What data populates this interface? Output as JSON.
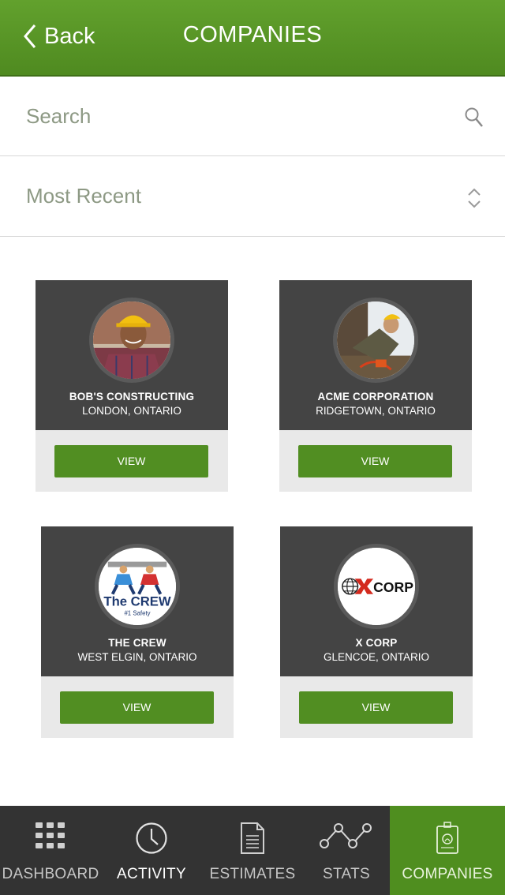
{
  "header": {
    "back_label": "Back",
    "title": "COMPANIES"
  },
  "search": {
    "placeholder": "Search"
  },
  "sort": {
    "selected": "Most Recent"
  },
  "companies": [
    {
      "name": "BOB'S CONSTRUCTING",
      "location": "LONDON, ONTARIO",
      "button": "VIEW"
    },
    {
      "name": "ACME CORPORATION",
      "location": "RIDGETOWN, ONTARIO",
      "button": "VIEW"
    },
    {
      "name": "THE CREW",
      "location": "WEST ELGIN, ONTARIO",
      "button": "VIEW",
      "logo_text": "The CREW",
      "logo_sub": "#1 Safety"
    },
    {
      "name": "X CORP",
      "location": "GLENCOE, ONTARIO",
      "button": "VIEW",
      "logo_text": "CORP"
    }
  ],
  "tabs": [
    {
      "label": "DASHBOARD",
      "icon": "grid-icon"
    },
    {
      "label": "ACTIVITY",
      "icon": "clock-icon"
    },
    {
      "label": "ESTIMATES",
      "icon": "document-icon"
    },
    {
      "label": "STATS",
      "icon": "line-graph-icon"
    },
    {
      "label": "COMPANIES",
      "icon": "badge-icon",
      "active": true
    }
  ],
  "colors": {
    "brand_green": "#518e22",
    "card_dark": "#444444",
    "tabbar": "#333333"
  }
}
